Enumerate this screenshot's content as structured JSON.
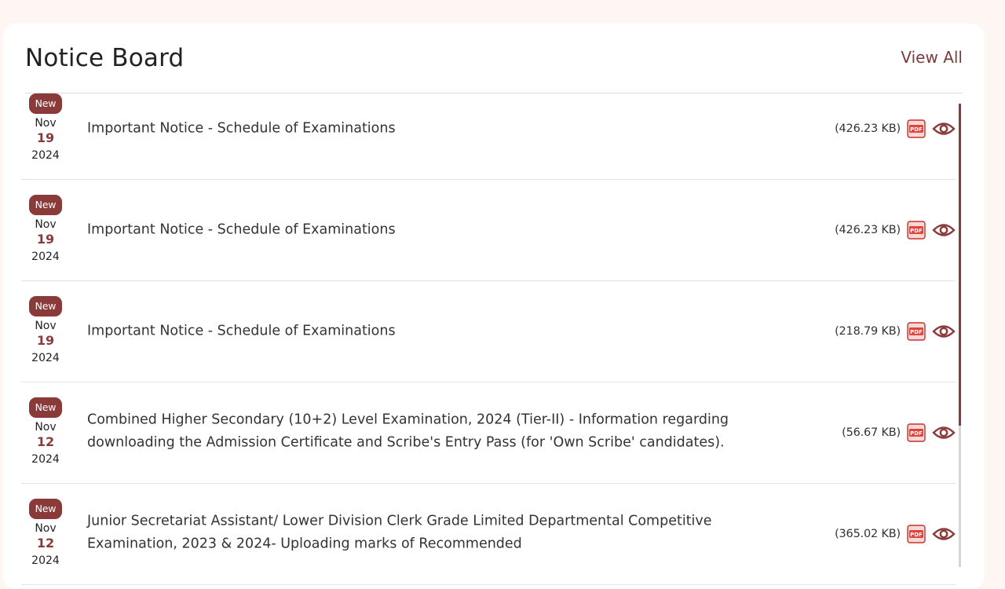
{
  "header": {
    "title": "Notice Board",
    "view_all_label": "View All"
  },
  "colors": {
    "accent": "#8b3a3a",
    "background": "#fdf6f3",
    "pdf_red": "#e0443a"
  },
  "icons": {
    "pdf": "pdf-file-icon",
    "view": "eye-icon"
  },
  "notices": [
    {
      "badge": "New",
      "month": "Nov",
      "day": "19",
      "year": "2024",
      "title": "Important Notice - Schedule of Examinations",
      "size": "(426.23 KB)"
    },
    {
      "badge": "New",
      "month": "Nov",
      "day": "19",
      "year": "2024",
      "title": "Important Notice - Schedule of Examinations",
      "size": "(426.23 KB)"
    },
    {
      "badge": "New",
      "month": "Nov",
      "day": "19",
      "year": "2024",
      "title": "Important Notice - Schedule of Examinations",
      "size": "(218.79 KB)"
    },
    {
      "badge": "New",
      "month": "Nov",
      "day": "12",
      "year": "2024",
      "title": "Combined Higher Secondary (10+2) Level Examination, 2024 (Tier-II) - Information regarding downloading the Admission Certificate and Scribe's Entry Pass (for 'Own Scribe' candidates).",
      "size": "(56.67 KB)"
    },
    {
      "badge": "New",
      "month": "Nov",
      "day": "12",
      "year": "2024",
      "title": "Junior Secretariat Assistant/ Lower Division Clerk Grade Limited Departmental Competitive Examination, 2023 & 2024- Uploading marks of Recommended",
      "size": "(365.02 KB)"
    }
  ]
}
